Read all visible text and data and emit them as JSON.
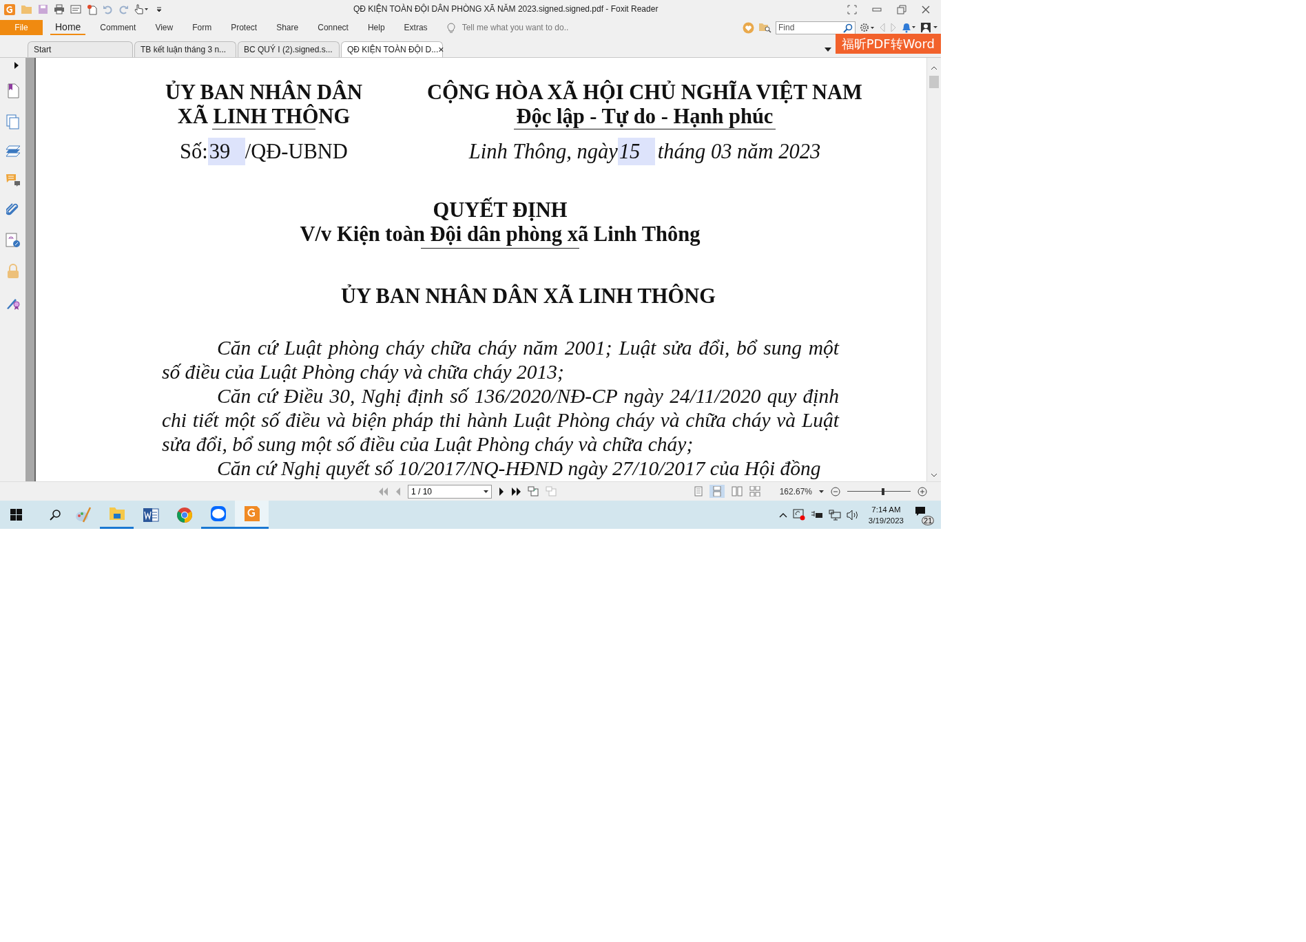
{
  "window": {
    "title": "QĐ KIỆN TOÀN ĐỘI DÂN PHÒNG XÃ NĂM 2023.signed.signed.pdf - Foxit Reader"
  },
  "file_button": "File",
  "ribbon_tabs": [
    {
      "label": "Home",
      "selected": true
    },
    {
      "label": "Comment",
      "selected": false
    },
    {
      "label": "View",
      "selected": false
    },
    {
      "label": "Form",
      "selected": false
    },
    {
      "label": "Protect",
      "selected": false
    },
    {
      "label": "Share",
      "selected": false
    },
    {
      "label": "Connect",
      "selected": false
    },
    {
      "label": "Help",
      "selected": false
    },
    {
      "label": "Extras",
      "selected": false
    }
  ],
  "tell_me": {
    "placeholder": "Tell me what you want to do.."
  },
  "find": {
    "placeholder": "Find"
  },
  "doc_tabs": [
    {
      "label": "Start",
      "selected": false
    },
    {
      "label": "TB kết luận tháng 3 n...",
      "selected": false
    },
    {
      "label": "BC QUÝ I (2).signed.s...",
      "selected": false
    },
    {
      "label": "QĐ KIỆN TOÀN ĐỘI D...",
      "selected": true,
      "close": "×"
    }
  ],
  "promo": "福昕PDF转Word",
  "document": {
    "left_header": [
      "ỦY BAN NHÂN DÂN",
      "XÃ LINH THÔNG"
    ],
    "right_header": [
      "CỘNG HÒA XÃ HỘI CHỦ NGHĨA VIỆT NAM",
      "Độc lập - Tự do - Hạnh phúc"
    ],
    "number": {
      "prefix": "Số:",
      "value": "39",
      "suffix": "/QĐ-UBND"
    },
    "date": {
      "prefix": "Linh Thông, ngày",
      "value": "15",
      "suffix": "tháng 03  năm 2023"
    },
    "title": "QUYẾT ĐỊNH",
    "subtitle": "V/v Kiện toàn Đội dân phòng xã Linh Thông",
    "authority": "ỦY BAN NHÂN DÂN XÃ LINH THÔNG",
    "paragraphs": [
      "Căn cứ  Luật phòng cháy chữa cháy năm 2001; Luật sửa đổi, bổ sung một số điều của Luật Phòng cháy và chữa cháy 2013;",
      "Căn cứ Điều 30, Nghị định số 136/2020/NĐ-CP ngày 24/11/2020 quy định chi tiết một số điều và biện pháp thi hành Luật Phòng cháy và chữa cháy và Luật sửa đổi, bổ sung một số điều của Luật Phòng cháy và chữa cháy;",
      "Căn cứ Nghị quyết số 10/2017/NQ-HĐND ngày 27/10/2017 của Hội đồng"
    ]
  },
  "status_bar": {
    "page": "1 / 10",
    "zoom": "162.67%",
    "zoom_slider": {
      "level": 0.57
    }
  },
  "taskbar": {
    "apps": [
      {
        "kind": "paint",
        "running": false,
        "selected": false
      },
      {
        "kind": "folder",
        "running": true,
        "selected": false
      },
      {
        "kind": "word",
        "running": false,
        "selected": false
      },
      {
        "kind": "chrome",
        "running": false,
        "selected": false
      },
      {
        "kind": "zalo",
        "running": true,
        "selected": false
      },
      {
        "kind": "foxit",
        "running": true,
        "selected": true
      }
    ],
    "time": "7:14 AM",
    "date": "3/19/2023",
    "notifications": "21"
  }
}
